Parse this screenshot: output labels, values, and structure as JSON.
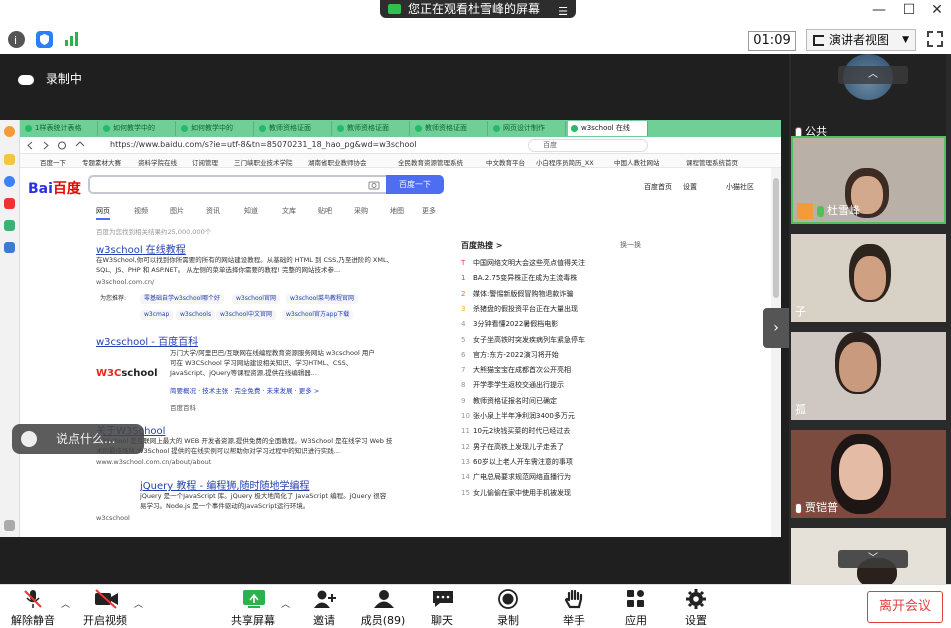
{
  "top": {
    "share_notice": "您正在观看杜雪峰的屏幕",
    "menu_glyph": "☰",
    "minimize": "—",
    "maximize": "☐",
    "close": "✕"
  },
  "info": {
    "time": "01:09",
    "view_mode": "演讲者视图"
  },
  "recording": {
    "label": "录制中"
  },
  "browser": {
    "tabs": [
      "1样表统计表格",
      "如何教学中的",
      "如何教学中的",
      "教师资格证面",
      "教师资格证面",
      "教师资格证面",
      "网页设计制作",
      "w3school 在线"
    ],
    "url": "https://www.baidu.com/s?ie=utf-8&tn=85070231_18_hao_pg&wd=w3school",
    "url_search": "百度",
    "bookmarks": [
      "百度一下",
      "专题素材大赛",
      "资料学院在线",
      "订阅管理",
      "三门峡职业技术学院",
      "湖南省职业教师协会",
      "全民教育资源管理系统",
      "中文教育平台",
      "小白程序员简历_XX",
      "中国人教社网站",
      "课程管理系统首页"
    ],
    "logo_text": "Bai",
    "logo_text2": "百度",
    "search_button": "百度一下",
    "top_links": [
      "百度首页",
      "设置",
      "小猫社区"
    ],
    "search_tabs": [
      "网页",
      "视频",
      "图片",
      "资讯",
      "知道",
      "文库",
      "贴吧",
      "采购",
      "地图",
      "更多"
    ],
    "result_count": "百度为您找到相关结果约25,000,000个",
    "results": [
      {
        "title": "w3school 在线教程",
        "desc": "在W3School,你可以找到你所需要的所有的网站建设教程。从基础的 HTML 到 CSS,乃至进阶的 XML、SQL、JS、PHP 和 ASP.NET。 从左侧的菜单选择你需要的教程! 完整的网站技术参...",
        "url": "w3school.com.cn/",
        "chips": [
          "为您推荐:",
          "零基础自学w3school哪个好",
          "w3school官网",
          "w3school菜鸟教程官网",
          "w3cmap",
          "w3schools",
          "w3school中文官网",
          "w3school官方app下载"
        ]
      },
      {
        "title": "w3cschool - 百度百科",
        "desc": "万门大学/阿里巴巴/互联网在线编程教育资源服务网站 w3cschool 用户可在 W3CSchool 学习网站建设相关知识、学习HTML、CSS、JavaScript、jQuery等课程资源,提供在线编辑器...",
        "logo_a": "W3C",
        "logo_b": "school",
        "links": "简要概况 · 技术主张 · 完全免费 · 未来发展 · 更多 >",
        "url": "百度百科"
      },
      {
        "title": "关于W3School",
        "desc": "W3School 是互联网上最大的 WEB 开发者资源,提供免费的全面教程。W3School 是在线学习 Web 技术的最佳场所,W3School 提供的在线实例可以帮助你对学习过程中的知识进行实践...",
        "url": "www.w3school.com.cn/about/about"
      },
      {
        "title": "jQuery 教程 - 编程狮,随时随地学编程",
        "desc": "jQuery 是一个JavaScript 库。jQuery 极大地简化了 JavaScript 编程。jQuery 很容易学习。Node.js 是一个事件驱动的JavaScript运行环境。",
        "url": "w3cschool"
      }
    ],
    "hot_title": "百度热搜 >",
    "hot_refresh": "换一换",
    "hot_items": [
      {
        "n": "T",
        "t": "中国网络文明大会这些亮点值得关注"
      },
      {
        "n": "1",
        "t": "BA.2.75变异株正在成为主流毒株"
      },
      {
        "n": "2",
        "t": "媒体:警惕新版假冒购物退款诈骗"
      },
      {
        "n": "3",
        "t": "杀猪盘的假投资平台正在大量出现"
      },
      {
        "n": "4",
        "t": "3分钟看懂2022暑假档电影"
      },
      {
        "n": "5",
        "t": "女子坐高铁时突发疾病列车紧急停车"
      },
      {
        "n": "6",
        "t": "官方:东方-2022演习将开始"
      },
      {
        "n": "7",
        "t": "大熊猫宝宝在成都首次公开亮相"
      },
      {
        "n": "8",
        "t": "开学季学生返校交通出行提示"
      },
      {
        "n": "9",
        "t": "教师资格证报名时间已确定"
      },
      {
        "n": "10",
        "t": "张小泉上半年净利润3400多万元"
      },
      {
        "n": "11",
        "t": "10元2块钱买菜的时代已经过去"
      },
      {
        "n": "12",
        "t": "男子在高铁上发现儿子走丢了"
      },
      {
        "n": "13",
        "t": "60岁以上老人开车需注意的事项"
      },
      {
        "n": "14",
        "t": "广电总局要求规范网络直播行为"
      },
      {
        "n": "15",
        "t": "女儿偷偷在家中使用手机被发现"
      }
    ]
  },
  "chat": {
    "placeholder": "说点什么..."
  },
  "gallery": {
    "tiles": [
      {
        "name": "公共"
      },
      {
        "name": "杜雪峰"
      },
      {
        "name": "子"
      },
      {
        "name": "孤"
      },
      {
        "name": "贾铠普"
      },
      {
        "name": ""
      }
    ],
    "collapse": "›",
    "up": "︿",
    "down": "﹀"
  },
  "toolbar": {
    "unmute": "解除静音",
    "start_video": "开启视频",
    "share_screen": "共享屏幕",
    "invite": "邀请",
    "members": "成员(89)",
    "chat": "聊天",
    "record": "录制",
    "raise_hand": "举手",
    "apps": "应用",
    "settings": "设置",
    "leave": "离开会议"
  },
  "colors": {
    "tabstrip": "#6fcf97",
    "baidu_blue": "#4e6ef2",
    "leave_red": "#e04040",
    "active_border": "#4fc05a"
  }
}
